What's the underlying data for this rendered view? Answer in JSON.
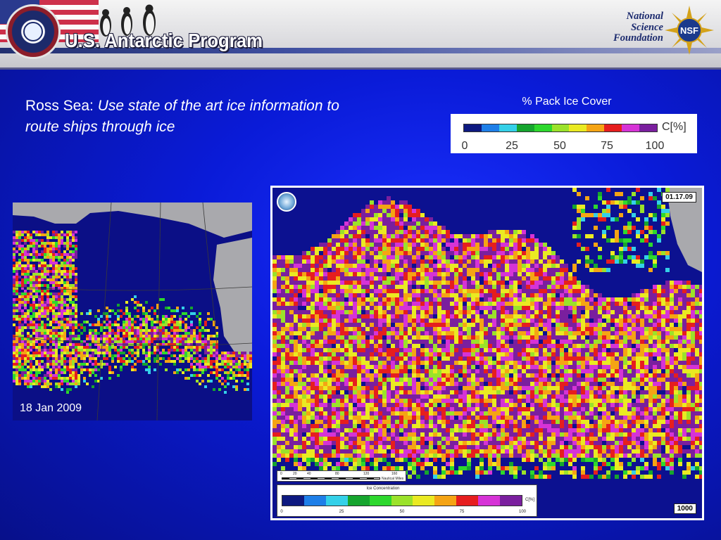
{
  "header": {
    "program_title": "U.S. Antarctic Program",
    "nsf_line1": "National",
    "nsf_line2": "Science",
    "nsf_line3": "Foundation",
    "nsf_logo_text": "NSF"
  },
  "headline": {
    "prefix": "Ross Sea: ",
    "italic": "Use state of the art ice information to route ships through ice"
  },
  "legend": {
    "title": "% Pack Ice Cover",
    "unit": "C[%]",
    "ticks": [
      "0",
      "25",
      "50",
      "75",
      "100"
    ],
    "colors": [
      "#0d1980",
      "#1e7fe8",
      "#34d0e8",
      "#16a52e",
      "#2dd82d",
      "#9be22a",
      "#eaea22",
      "#f5a414",
      "#e61e1e",
      "#d633d6",
      "#7a1f9e"
    ]
  },
  "left_map": {
    "caption": "18 Jan 2009"
  },
  "right_map": {
    "date": "01.17.09",
    "scale_label": "Nautical Miles",
    "scale_ticks": [
      "0",
      "20",
      "40",
      "80",
      "120",
      "160"
    ],
    "conc_title": "Ice Concentration",
    "conc_unit": "C[%]",
    "conc_ticks": [
      "0",
      "25",
      "50",
      "75",
      "100"
    ],
    "scale_number": "1000"
  }
}
